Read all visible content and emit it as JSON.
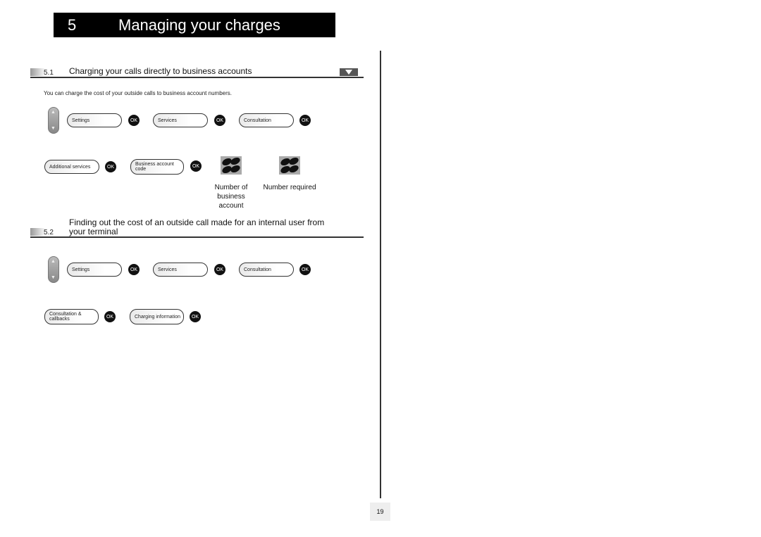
{
  "chapter": {
    "number": "5",
    "title": "Managing your charges"
  },
  "section1": {
    "number": "5.1",
    "title": "Charging your calls directly to business accounts",
    "intro": "You can charge the cost of your outside calls to business account numbers.",
    "row1": [
      "Settings",
      "Services",
      "Consultation"
    ],
    "row2": [
      "Additional services",
      "Business account code"
    ],
    "ok": "OK",
    "keypad_labels": [
      "Number of business account",
      "Number required"
    ]
  },
  "section2": {
    "number": "5.2",
    "title_line1": "Finding out the cost of an outside call made for an internal user from",
    "title_line2": "your terminal",
    "row1": [
      "Settings",
      "Services",
      "Consultation"
    ],
    "row2": [
      "Consultation & callbacks",
      "Charging information"
    ],
    "ok": "OK"
  },
  "icons": {
    "nav": "up-down-navigator-icon",
    "keypad": "keypad-icon",
    "down": "down-arrow-icon"
  },
  "page_number": "19"
}
